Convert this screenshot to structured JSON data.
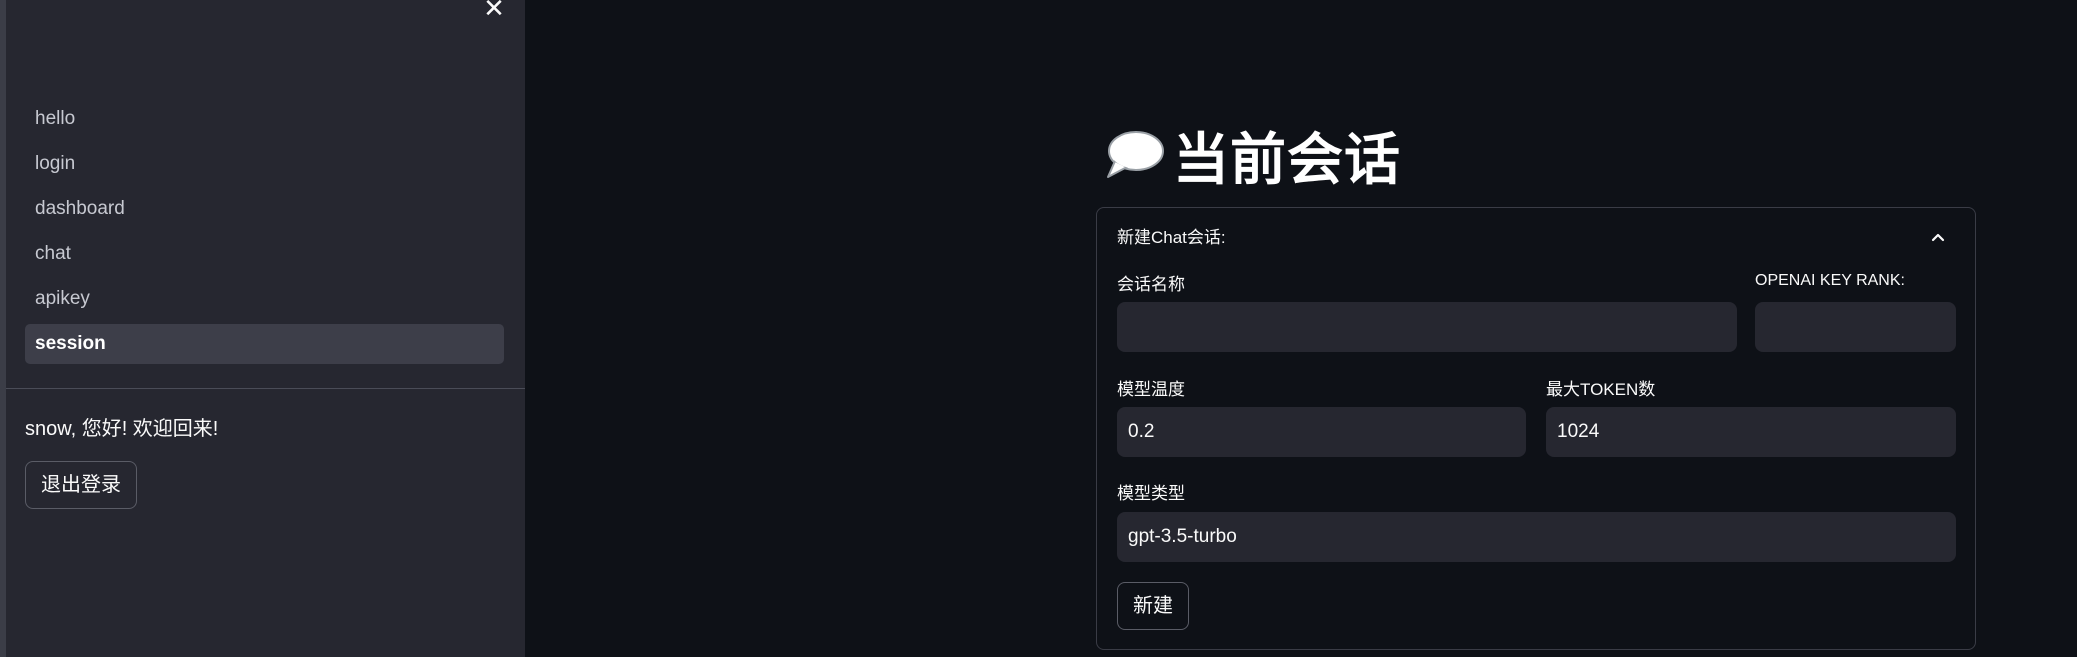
{
  "sidebar": {
    "close_icon": "close-icon",
    "nav_items": [
      {
        "label": "hello"
      },
      {
        "label": "login"
      },
      {
        "label": "dashboard"
      },
      {
        "label": "chat"
      },
      {
        "label": "apikey"
      },
      {
        "label": "session"
      }
    ],
    "active_item": "session",
    "welcome_text": "snow, 您好! 欢迎回来!",
    "logout_label": "退出登录"
  },
  "main": {
    "title_icon": "speech-bubble-icon",
    "title": "当前会话",
    "expander": {
      "header": "新建Chat会话:",
      "expanded": true,
      "fields": {
        "session_name": {
          "label": "会话名称",
          "value": ""
        },
        "openai_key_rank": {
          "label": "OPENAI KEY RANK:",
          "value": ""
        },
        "temperature": {
          "label": "模型温度",
          "value": "0.2"
        },
        "max_tokens": {
          "label": "最大TOKEN数",
          "value": "1024"
        },
        "model_type": {
          "label": "模型类型",
          "value": "gpt-3.5-turbo"
        }
      },
      "create_label": "新建"
    }
  },
  "colors": {
    "background": "#0e1117",
    "sidebar": "#262730",
    "input": "#262730",
    "text": "#fafafa"
  }
}
